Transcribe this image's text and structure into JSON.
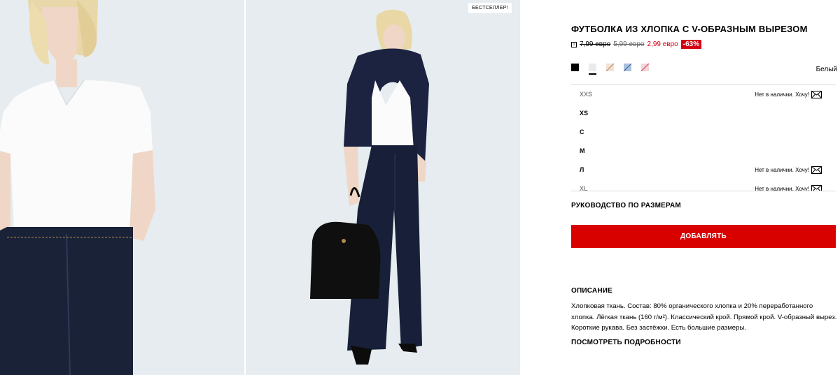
{
  "gallery": {
    "badge": "БЕСТСЕЛЛЕР!",
    "background": "#e6ecef"
  },
  "product": {
    "title": "ФУТБОЛКА ИЗ ХЛОПКА С V-ОБРАЗНЫМ ВЫРЕЗОМ",
    "info_icon": "i",
    "price_original": "7,99 евро",
    "price_previous": "5,99 евро",
    "price_current": "2,99 евро",
    "discount": "-63%",
    "accent_color": "#d40014",
    "selected_color": "Белый",
    "colors": [
      {
        "name": "black",
        "hex": "#000000"
      },
      {
        "name": "white",
        "hex": "#ebebeb"
      },
      {
        "name": "beige-unavailable",
        "hex": "#e8d6c7"
      },
      {
        "name": "blue-unavailable",
        "hex": "#7fa3cf"
      },
      {
        "name": "pink-unavailable",
        "hex": "#e9a0b0"
      }
    ]
  },
  "sizes": [
    {
      "label": "XXS",
      "stock": "Нет в наличии. Хочу!",
      "available": false
    },
    {
      "label": "XS",
      "stock": "",
      "available": true
    },
    {
      "label": "С",
      "stock": "",
      "available": true
    },
    {
      "label": "М",
      "stock": "",
      "available": true
    },
    {
      "label": "Л",
      "stock": "Нет в наличии. Хочу!",
      "available": true
    },
    {
      "label": "XL",
      "stock": "Нет в наличии. Хочу!",
      "available": false
    }
  ],
  "actions": {
    "size_guide": "РУКОВОДСТВО ПО РАЗМЕРАМ",
    "add": "ДОБАВЛЯТЬ",
    "details": "ПОСМОТРЕТЬ ПОДРОБНОСТИ"
  },
  "description": {
    "title": "ОПИСАНИЕ",
    "text": "Хлопковая ткань. Состав: 80% органического хлопка и 20% переработанного хлопка. Лёгкая ткань (160 г/м²). Классический крой. Прямой крой. V-образный вырез. Короткие рукава. Без застёжки. Есть большие размеры."
  }
}
